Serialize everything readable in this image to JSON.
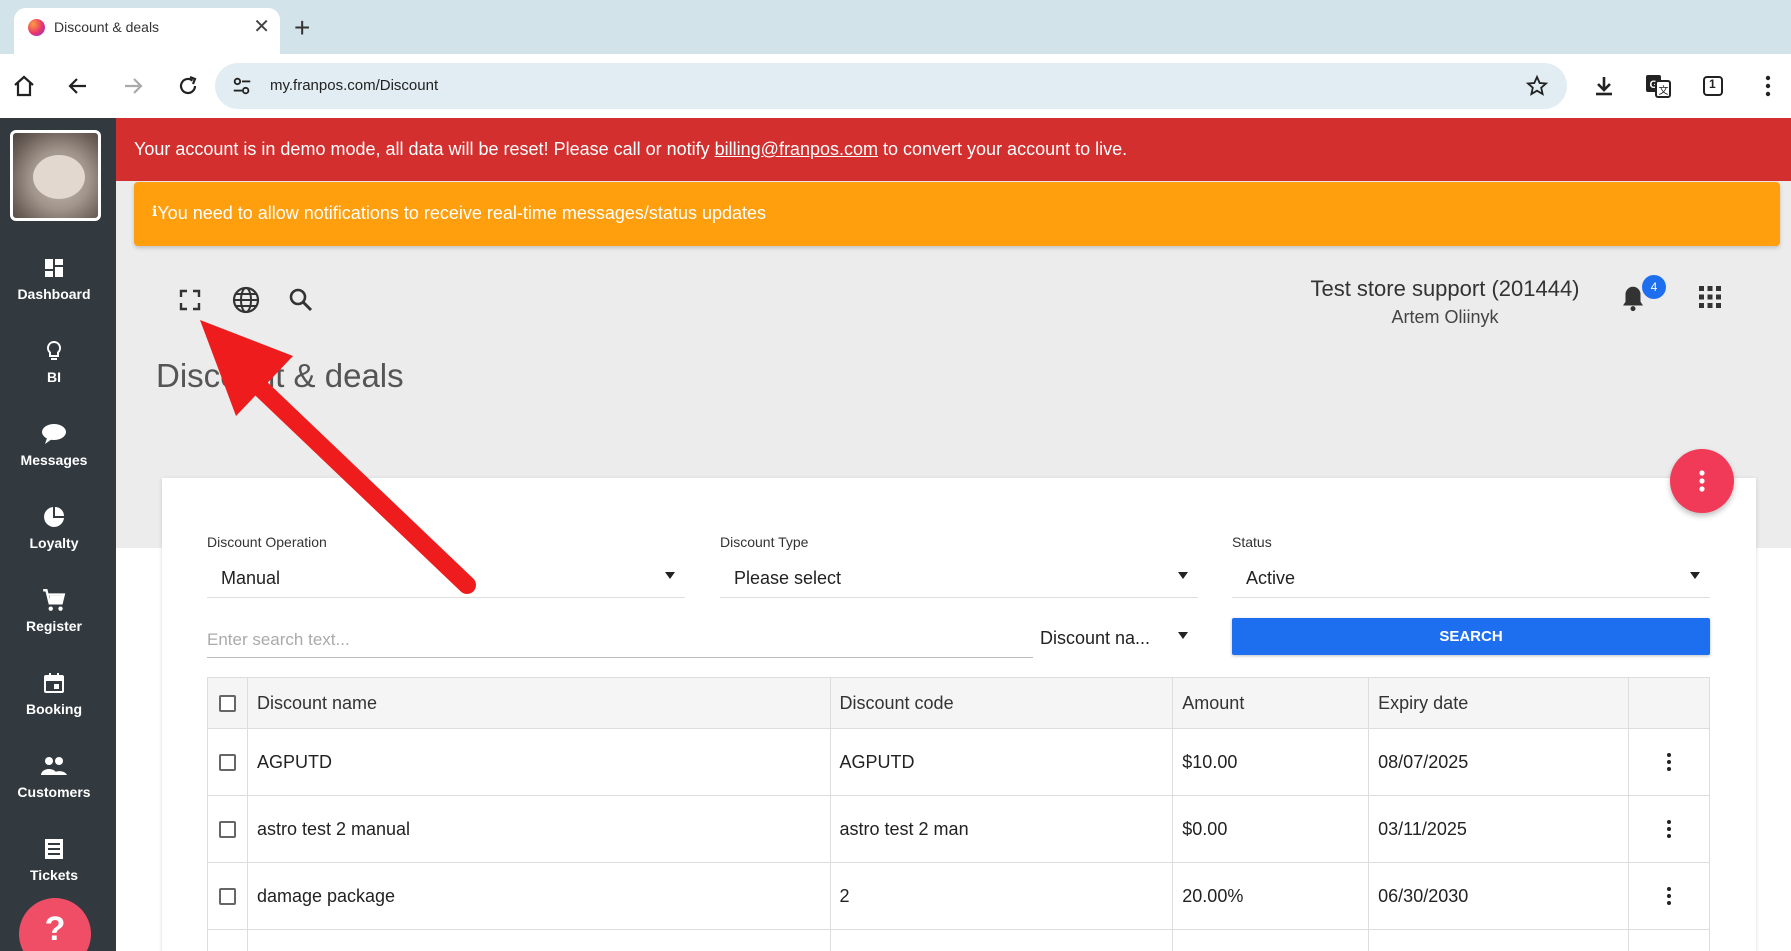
{
  "browser": {
    "tab_title": "Discount & deals",
    "new_tab_label": "+",
    "url": "my.franpos.com/Discount",
    "tab_count": "1"
  },
  "sidebar": {
    "items": [
      {
        "label": "Dashboard",
        "icon": "dashboard-icon"
      },
      {
        "label": "BI",
        "icon": "lightbulb-icon"
      },
      {
        "label": "Messages",
        "icon": "chat-bubble-icon"
      },
      {
        "label": "Loyalty",
        "icon": "pie-chart-icon"
      },
      {
        "label": "Register",
        "icon": "cart-icon"
      },
      {
        "label": "Booking",
        "icon": "calendar-icon"
      },
      {
        "label": "Customers",
        "icon": "people-icon"
      },
      {
        "label": "Tickets",
        "icon": "receipt-icon"
      }
    ],
    "help_label": "?"
  },
  "banners": {
    "demo_prefix": "Your account is in demo mode, all data will be reset! Please call or notify ",
    "demo_link": "billing@franpos.com",
    "demo_suffix": " to convert your account to live.",
    "notification_icon": "ℹ",
    "notification": "You need to allow notifications to receive real-time messages/status updates"
  },
  "header": {
    "store_name": "Test store support (201444)",
    "user_name": "Artem Oliinyk",
    "notification_count": "4"
  },
  "page": {
    "title": "Discount & deals"
  },
  "filters": {
    "operation_label": "Discount Operation",
    "operation_value": "Manual",
    "type_label": "Discount Type",
    "type_value": "Please select",
    "status_label": "Status",
    "status_value": "Active",
    "search_placeholder": "Enter search text...",
    "search_field_value": "Discount na...",
    "search_button": "SEARCH"
  },
  "table": {
    "headers": [
      "Discount name",
      "Discount code",
      "Amount",
      "Expiry date"
    ],
    "rows": [
      {
        "name": "AGPUTD",
        "code": "AGPUTD",
        "amount": "$10.00",
        "expiry": "08/07/2025"
      },
      {
        "name": "astro test 2 manual",
        "code": "astro test 2 man",
        "amount": "$0.00",
        "expiry": "03/11/2025"
      },
      {
        "name": "damage package",
        "code": "2",
        "amount": "20.00%",
        "expiry": "06/30/2030"
      },
      {
        "name": "",
        "code": "",
        "amount": "",
        "expiry": ""
      }
    ]
  },
  "colors": {
    "demo_banner": "#d32f2f",
    "notification_banner": "#ff9f0e",
    "primary_button": "#1e6ff0",
    "fab": "#f03a57",
    "sidebar": "#333a3f",
    "annotation_arrow": "#ee1c1c"
  }
}
